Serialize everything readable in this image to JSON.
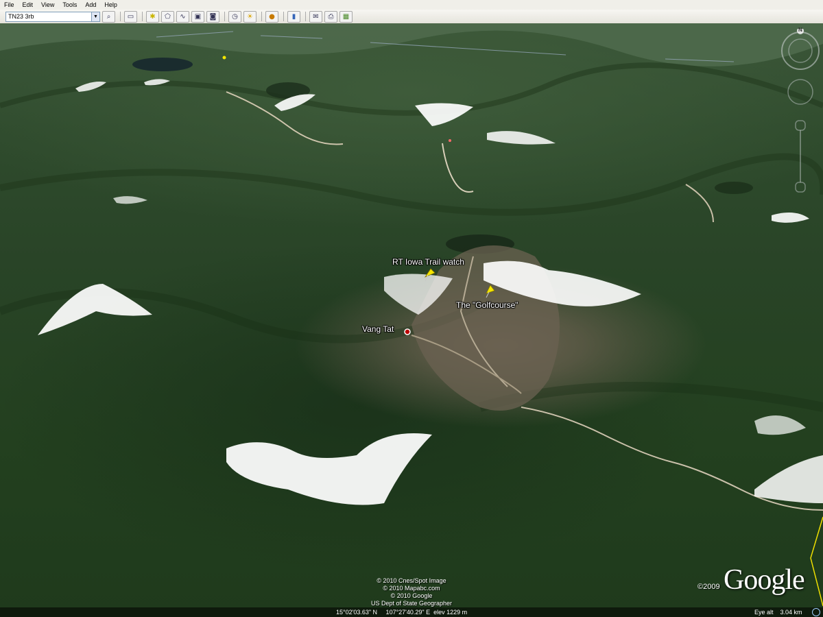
{
  "menu": {
    "items": [
      "File",
      "Edit",
      "View",
      "Tools",
      "Add",
      "Help"
    ]
  },
  "toolbar": {
    "layer_select_value": "TN23 3rb",
    "buttons": [
      {
        "name": "search-button",
        "icon": "magnifier-icon",
        "glyph": "🔍"
      },
      {
        "name": "sidebar-toggle-button",
        "icon": "sidebar-icon",
        "glyph": "▭"
      },
      {
        "name": "add-placemark-button",
        "icon": "pushpin-icon",
        "glyph": "📌"
      },
      {
        "name": "add-polygon-button",
        "icon": "polygon-icon",
        "glyph": "⬠"
      },
      {
        "name": "add-path-button",
        "icon": "path-icon",
        "glyph": "〰"
      },
      {
        "name": "add-image-overlay-button",
        "icon": "overlay-icon",
        "glyph": "🖼"
      },
      {
        "name": "record-tour-button",
        "icon": "camera-icon",
        "glyph": "🎥"
      },
      {
        "name": "historical-imagery-button",
        "icon": "clock-icon",
        "glyph": "🕒"
      },
      {
        "name": "sunlight-button",
        "icon": "sun-icon",
        "glyph": "☀"
      },
      {
        "name": "planets-button",
        "icon": "planet-icon",
        "glyph": "🪐"
      },
      {
        "name": "ruler-button",
        "icon": "ruler-icon",
        "glyph": "📏"
      },
      {
        "name": "email-button",
        "icon": "email-icon",
        "glyph": "✉"
      },
      {
        "name": "print-button",
        "icon": "printer-icon",
        "glyph": "🖶"
      },
      {
        "name": "view-in-maps-button",
        "icon": "map-icon",
        "glyph": "🗺"
      }
    ]
  },
  "placemarks": {
    "rt_iowa": "RT Iowa Trail watch",
    "golfcourse": "The \"Golfcourse\"",
    "vang_tat": "Vang Tat"
  },
  "attribution": {
    "line1": "© 2010 Cnes/Spot Image",
    "line2": "© 2010 Mapabc.com",
    "line3": "© 2010 Google",
    "line4": "US Dept of State Geographer"
  },
  "status": {
    "coordinates": "15°02'03.63\" N     107°27'40.29\" E  elev 1229 m",
    "eye_alt_label": "Eye alt",
    "eye_alt_value": "3.04 km"
  },
  "logo": {
    "text": "Google",
    "year": "©2009"
  },
  "navigation": {
    "north_label": "N"
  }
}
